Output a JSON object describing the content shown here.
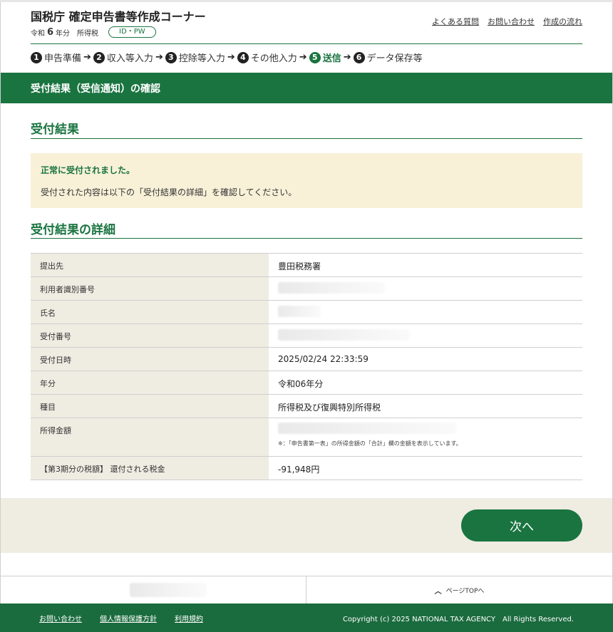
{
  "header": {
    "title": "国税庁 確定申告書等作成コーナー",
    "era": "令和",
    "year": "6",
    "year_suffix": "年分",
    "tax_type": "所得税",
    "id_badge": "ID・PW",
    "links": [
      "よくある質問",
      "お問い合わせ",
      "作成の流れ"
    ]
  },
  "steps": [
    {
      "num": "1",
      "label": "申告準備"
    },
    {
      "num": "2",
      "label": "収入等入力"
    },
    {
      "num": "3",
      "label": "控除等入力"
    },
    {
      "num": "4",
      "label": "その他入力"
    },
    {
      "num": "5",
      "label": "送信"
    },
    {
      "num": "6",
      "label": "データ保存等"
    }
  ],
  "band_title": "受付結果（受信通知）の確認",
  "result": {
    "title": "受付結果",
    "notice_strong": "正常に受付されました。",
    "notice_body": "受付された内容は以下の「受付結果の詳細」を確認してください。"
  },
  "detail": {
    "title": "受付結果の詳細",
    "rows": [
      {
        "label": "提出先",
        "value": "豊田税務署"
      },
      {
        "label": "利用者識別番号",
        "value": ""
      },
      {
        "label": "氏名",
        "value": ""
      },
      {
        "label": "受付番号",
        "value": ""
      },
      {
        "label": "受付日時",
        "value": "2025/02/24 22:33:59"
      },
      {
        "label": "年分",
        "value": "令和06年分"
      },
      {
        "label": "種目",
        "value": "所得税及び復興特別所得税"
      },
      {
        "label": "所得金額",
        "value": "",
        "note": "※：「申告書第一表」の所得金額の「合計」欄の金額を表示しています。"
      },
      {
        "label": "【第3期分の税額】 還付される税金",
        "value": "-91,948円"
      }
    ]
  },
  "next_button": "次へ",
  "page_top": "ページTOPへ",
  "footer": {
    "links": [
      "お問い合わせ",
      "個人情報保護方針",
      "利用規約"
    ],
    "copyright": "Copyright (c) 2025 NATIONAL TAX AGENCY　All Rights Reserved."
  },
  "colors": {
    "brand_green": "#1a7440",
    "notice_bg": "#f8f1d8",
    "label_bg": "#efece2"
  }
}
